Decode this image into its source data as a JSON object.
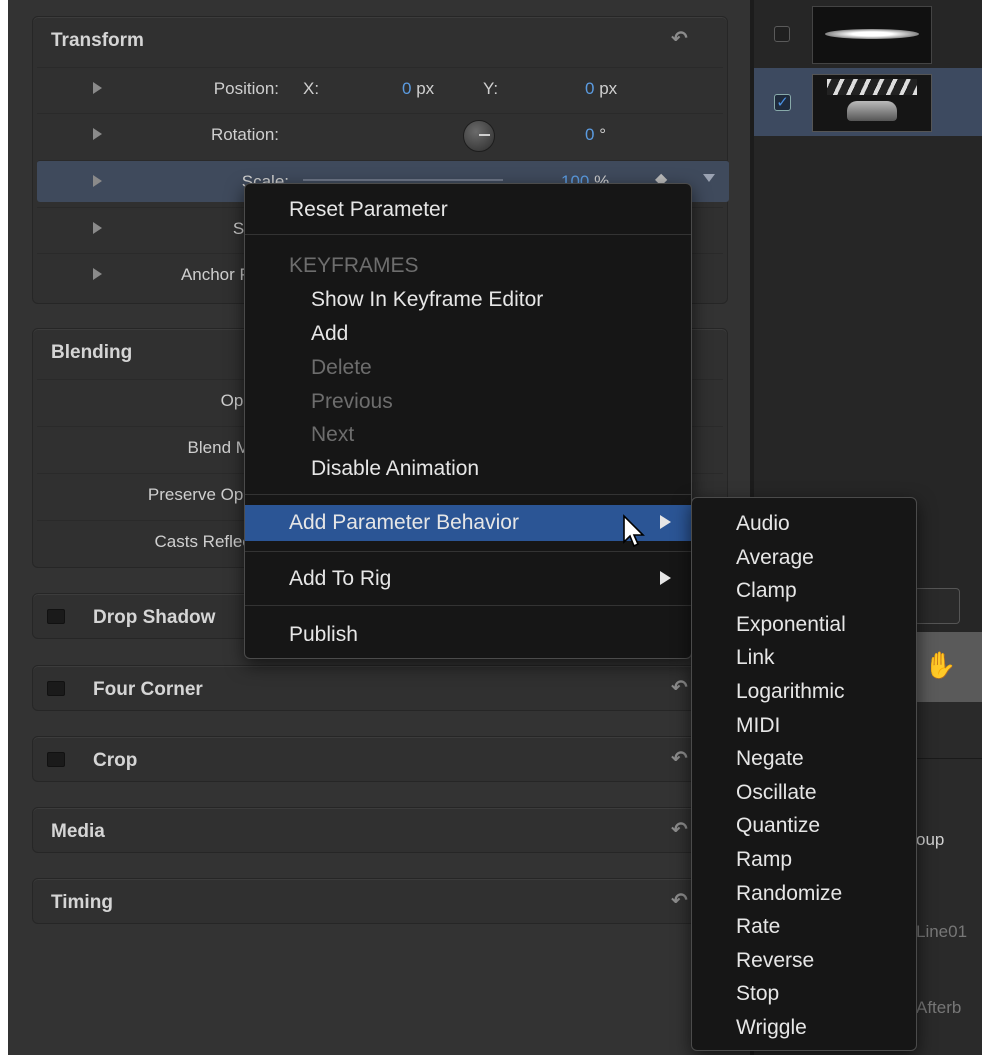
{
  "inspector": {
    "transform": {
      "title": "Transform",
      "reset": "↶",
      "rows": {
        "position": {
          "label": "Position:",
          "x_label": "X:",
          "x_value": "0",
          "x_unit": "px",
          "y_label": "Y:",
          "y_value": "0",
          "y_unit": "px"
        },
        "rotation": {
          "label": "Rotation:",
          "value": "0",
          "unit": "°"
        },
        "scale": {
          "label": "Scale:",
          "value": "100",
          "unit": "%"
        },
        "shear": {
          "label": "Shear:"
        },
        "anchor": {
          "label": "Anchor Point:"
        }
      }
    },
    "blending": {
      "title": "Blending",
      "rows": [
        "Opacity:",
        "Blend Mode:",
        "Preserve Opacity:",
        "Casts Reflection:"
      ]
    },
    "drop_shadow": {
      "title": "Drop Shadow"
    },
    "four_corner": {
      "title": "Four Corner"
    },
    "crop": {
      "title": "Crop"
    },
    "media": {
      "title": "Media"
    },
    "timing": {
      "title": "Timing"
    }
  },
  "context_menu": {
    "reset": "Reset Parameter",
    "keyframes_header": "KEYFRAMES",
    "show_in_editor": "Show In Keyframe Editor",
    "add": "Add",
    "delete": "Delete",
    "previous": "Previous",
    "next": "Next",
    "disable_animation": "Disable Animation",
    "add_behavior": "Add Parameter Behavior",
    "add_to_rig": "Add To Rig",
    "publish": "Publish"
  },
  "submenu": {
    "items": [
      "Audio",
      "Average",
      "Clamp",
      "Exponential",
      "Link",
      "Logarithmic",
      "MIDI",
      "Negate",
      "Oscillate",
      "Quantize",
      "Ramp",
      "Randomize",
      "Rate",
      "Reverse",
      "Stop",
      "Wriggle"
    ]
  },
  "right_panel": {
    "layer_partial_1": "oup",
    "layer_partial_2": "Line01",
    "layer_partial_3": "Afterb"
  },
  "colors": {
    "accent": "#2b5595",
    "value_blue": "#5b9be0",
    "check_blue": "#4a90e2"
  }
}
